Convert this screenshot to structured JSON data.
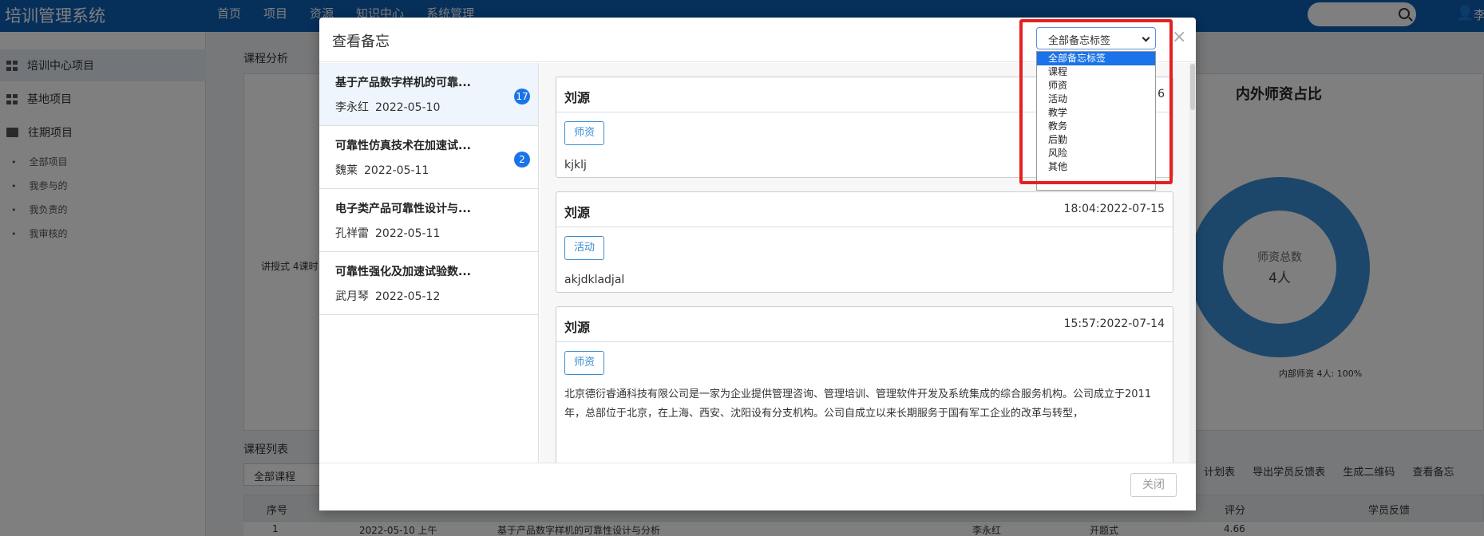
{
  "app": {
    "title": "培训管理系统",
    "user": "李"
  },
  "topnav": [
    "首页",
    "项目",
    "资源",
    "知识中心",
    "系统管理"
  ],
  "sidebar": {
    "items": [
      {
        "label": "培训中心项目"
      },
      {
        "label": "基地项目"
      },
      {
        "label": "往期项目"
      }
    ],
    "subitems": [
      "全部项目",
      "我参与的",
      "我负责的",
      "我审核的"
    ]
  },
  "page": {
    "analysis_label": "课程分析",
    "course_list_label": "课程列表",
    "chart_title": "内外师资占比",
    "donut_center_label": "师资总数",
    "donut_center_value": "4人",
    "donut_legend": "内部师资 4人: 100%",
    "left_axis_text": "讲授式 4课时",
    "filter_value": "全部课程",
    "toolbar_links": [
      "计划表",
      "导出学员反馈表",
      "生成二维码",
      "查看备忘"
    ],
    "table_headers": [
      "序号",
      "评分",
      "学员反馈"
    ],
    "table_row1": {
      "no": "1",
      "date": "2022-05-10 上午",
      "name": "基于产品数字样机的可靠性设计与分析",
      "teacher": "李永红",
      "type": "开题式",
      "score": "4.66"
    }
  },
  "modal": {
    "title": "查看备忘",
    "tag_filter": {
      "selected": "全部备忘标签",
      "options": [
        "全部备忘标签",
        "课程",
        "师资",
        "活动",
        "教学",
        "教务",
        "后勤",
        "风险",
        "其他"
      ]
    },
    "close_x": "×",
    "list": [
      {
        "title": "基于产品数字样机的可靠...",
        "person": "李永红",
        "date": "2022-05-10",
        "badge": "17"
      },
      {
        "title": "可靠性仿真技术在加速试...",
        "person": "魏莱",
        "date": "2022-05-11",
        "badge": "2"
      },
      {
        "title": "电子类产品可靠性设计与...",
        "person": "孔祥雷",
        "date": "2022-05-11",
        "badge": ""
      },
      {
        "title": "可靠性强化及加速试验数...",
        "person": "武月琴",
        "date": "2022-05-12",
        "badge": ""
      }
    ],
    "memos": [
      {
        "author": "刘源",
        "time": "6",
        "tag": "师资",
        "text": "kjklj"
      },
      {
        "author": "刘源",
        "time": "18:04:2022-07-15",
        "tag": "活动",
        "text": "akjdkladjal"
      },
      {
        "author": "刘源",
        "time": "15:57:2022-07-14",
        "tag": "师资",
        "text": "北京德衍睿通科技有限公司是一家为企业提供管理咨询、管理培训、管理软件开发及系统集成的综合服务机构。公司成立于2011年，总部位于北京，在上海、西安、沈阳设有分支机构。公司自成立以来长期服务于国有军工企业的改革与转型，"
      }
    ],
    "close_button": "关闭"
  },
  "colors": {
    "brand": "#0d5fb5",
    "accent": "#1a73e8",
    "tag": "#3b8ed4",
    "highlight": "#e52020"
  }
}
